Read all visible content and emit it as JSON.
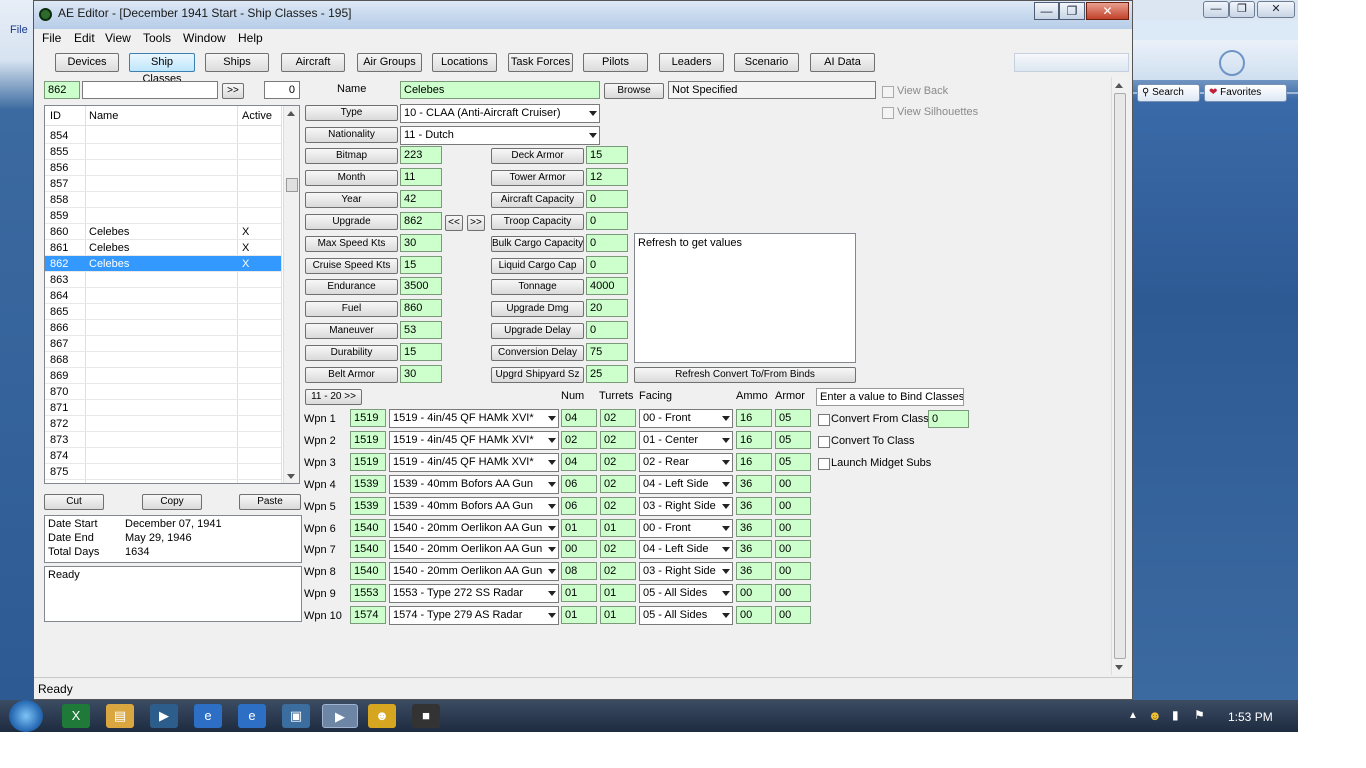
{
  "app": {
    "title": "AE Editor - [December 1941 Start - Ship Classes - 195]"
  },
  "menu": [
    "File",
    "Edit",
    "View",
    "Tools",
    "Window",
    "Help"
  ],
  "tabs": [
    {
      "label": "Devices",
      "active": false
    },
    {
      "label": "Ship Classes",
      "active": true
    },
    {
      "label": "Ships",
      "active": false
    },
    {
      "label": "Aircraft",
      "active": false
    },
    {
      "label": "Air Groups",
      "active": false
    },
    {
      "label": "Locations",
      "active": false
    },
    {
      "label": "Task Forces",
      "active": false
    },
    {
      "label": "Pilots",
      "active": false
    },
    {
      "label": "Leaders",
      "active": false
    },
    {
      "label": "Scenario",
      "active": false
    },
    {
      "label": "AI Data",
      "active": false
    }
  ],
  "search": {
    "id_value": "862",
    "name_value": "",
    "next_label": ">>",
    "count_value": "0"
  },
  "list": {
    "headers": [
      "ID",
      "Name",
      "Active"
    ],
    "rows": [
      {
        "id": "854",
        "name": "",
        "active": ""
      },
      {
        "id": "855",
        "name": "",
        "active": ""
      },
      {
        "id": "856",
        "name": "",
        "active": ""
      },
      {
        "id": "857",
        "name": "",
        "active": ""
      },
      {
        "id": "858",
        "name": "",
        "active": ""
      },
      {
        "id": "859",
        "name": "",
        "active": ""
      },
      {
        "id": "860",
        "name": "Celebes",
        "active": "X"
      },
      {
        "id": "861",
        "name": "Celebes",
        "active": "X"
      },
      {
        "id": "862",
        "name": "Celebes",
        "active": "X",
        "selected": true
      },
      {
        "id": "863",
        "name": "",
        "active": ""
      },
      {
        "id": "864",
        "name": "",
        "active": ""
      },
      {
        "id": "865",
        "name": "",
        "active": ""
      },
      {
        "id": "866",
        "name": "",
        "active": ""
      },
      {
        "id": "867",
        "name": "",
        "active": ""
      },
      {
        "id": "868",
        "name": "",
        "active": ""
      },
      {
        "id": "869",
        "name": "",
        "active": ""
      },
      {
        "id": "870",
        "name": "",
        "active": ""
      },
      {
        "id": "871",
        "name": "",
        "active": ""
      },
      {
        "id": "872",
        "name": "",
        "active": ""
      },
      {
        "id": "873",
        "name": "",
        "active": ""
      },
      {
        "id": "874",
        "name": "",
        "active": ""
      },
      {
        "id": "875",
        "name": "",
        "active": ""
      }
    ]
  },
  "clipboard": {
    "cut": "Cut",
    "copy": "Copy",
    "paste": "Paste"
  },
  "dates": {
    "start_label": "Date Start",
    "start_value": "December 07, 1941",
    "end_label": "Date End",
    "end_value": "May 29, 1946",
    "total_label": "Total Days",
    "total_value": "1634"
  },
  "log_text": "Ready",
  "ship": {
    "name_label": "Name",
    "name_value": "Celebes",
    "browse_label": "Browse",
    "image_path": "Not Specified",
    "view_back": "View Back",
    "view_silhouettes": "View Silhouettes",
    "type_label": "Type",
    "type_value": "10 - CLAA (Anti-Aircraft Cruiser)",
    "nationality_label": "Nationality",
    "nationality_value": "11 - Dutch",
    "left_fields": [
      {
        "label": "Bitmap",
        "value": "223"
      },
      {
        "label": "Month",
        "value": "11"
      },
      {
        "label": "Year",
        "value": "42"
      },
      {
        "label": "Upgrade",
        "value": "862"
      },
      {
        "label": "Max Speed Kts",
        "value": "30"
      },
      {
        "label": "Cruise Speed Kts",
        "value": "15"
      },
      {
        "label": "Endurance",
        "value": "3500"
      },
      {
        "label": "Fuel",
        "value": "860"
      },
      {
        "label": "Maneuver",
        "value": "53"
      },
      {
        "label": "Durability",
        "value": "15"
      },
      {
        "label": "Belt Armor",
        "value": "30"
      }
    ],
    "upgrade_prev": "<<",
    "upgrade_next": ">>",
    "right_fields": [
      {
        "label": "Deck Armor",
        "value": "15"
      },
      {
        "label": "Tower Armor",
        "value": "12"
      },
      {
        "label": "Aircraft Capacity",
        "value": "0"
      },
      {
        "label": "Troop Capacity",
        "value": "0"
      },
      {
        "label": "Bulk Cargo Capacity",
        "value": "0"
      },
      {
        "label": "Liquid Cargo Cap",
        "value": "0"
      },
      {
        "label": "Tonnage",
        "value": "4000"
      },
      {
        "label": "Upgrade Dmg",
        "value": "20"
      },
      {
        "label": "Upgrade Delay",
        "value": "0"
      },
      {
        "label": "Conversion Delay",
        "value": "75"
      },
      {
        "label": "Upgrd Shipyard Sz",
        "value": "25"
      }
    ],
    "refresh_text": "Refresh to get values",
    "refresh_button": "Refresh Convert To/From Binds"
  },
  "weapons": {
    "page_button": "11 - 20 >>",
    "headers": {
      "num": "Num",
      "turrets": "Turrets",
      "facing": "Facing",
      "ammo": "Ammo",
      "armor": "Armor"
    },
    "rows": [
      {
        "label": "Wpn 1",
        "code": "1519",
        "device": "1519 - 4in/45 QF HAMk XVI*",
        "num": "04",
        "turrets": "02",
        "facing": "00 - Front",
        "ammo": "16",
        "armor": "05"
      },
      {
        "label": "Wpn 2",
        "code": "1519",
        "device": "1519 - 4in/45 QF HAMk XVI*",
        "num": "02",
        "turrets": "02",
        "facing": "01 - Center",
        "ammo": "16",
        "armor": "05"
      },
      {
        "label": "Wpn 3",
        "code": "1519",
        "device": "1519 - 4in/45 QF HAMk XVI*",
        "num": "04",
        "turrets": "02",
        "facing": "02 - Rear",
        "ammo": "16",
        "armor": "05"
      },
      {
        "label": "Wpn 4",
        "code": "1539",
        "device": "1539 - 40mm Bofors AA Gun",
        "num": "06",
        "turrets": "02",
        "facing": "04 - Left Side",
        "ammo": "36",
        "armor": "00"
      },
      {
        "label": "Wpn 5",
        "code": "1539",
        "device": "1539 - 40mm Bofors AA Gun",
        "num": "06",
        "turrets": "02",
        "facing": "03 - Right Side",
        "ammo": "36",
        "armor": "00"
      },
      {
        "label": "Wpn 6",
        "code": "1540",
        "device": "1540 - 20mm Oerlikon AA Gun",
        "num": "01",
        "turrets": "01",
        "facing": "00 - Front",
        "ammo": "36",
        "armor": "00"
      },
      {
        "label": "Wpn 7",
        "code": "1540",
        "device": "1540 - 20mm Oerlikon AA Gun",
        "num": "00",
        "turrets": "02",
        "facing": "04 - Left Side",
        "ammo": "36",
        "armor": "00"
      },
      {
        "label": "Wpn 8",
        "code": "1540",
        "device": "1540 - 20mm Oerlikon AA Gun",
        "num": "08",
        "turrets": "02",
        "facing": "03 - Right Side",
        "ammo": "36",
        "armor": "00"
      },
      {
        "label": "Wpn 9",
        "code": "1553",
        "device": "1553 - Type 272 SS Radar",
        "num": "01",
        "turrets": "01",
        "facing": "05 - All Sides",
        "ammo": "00",
        "armor": "00"
      },
      {
        "label": "Wpn 10",
        "code": "1574",
        "device": "1574 - Type 279 AS Radar",
        "num": "01",
        "turrets": "01",
        "facing": "05 - All Sides",
        "ammo": "00",
        "armor": "00"
      }
    ]
  },
  "binds": {
    "header": "Enter a value to Bind Classes",
    "convert_from": "Convert From Class",
    "convert_from_value": "0",
    "convert_to": "Convert To Class",
    "midget_subs": "Launch Midget Subs"
  },
  "status": "Ready",
  "ie": {
    "search": "Search",
    "favorites": "Favorites"
  },
  "clock": "1:53 PM",
  "colors": {
    "field_green": "#ccffcc",
    "selection": "#3399ff"
  }
}
